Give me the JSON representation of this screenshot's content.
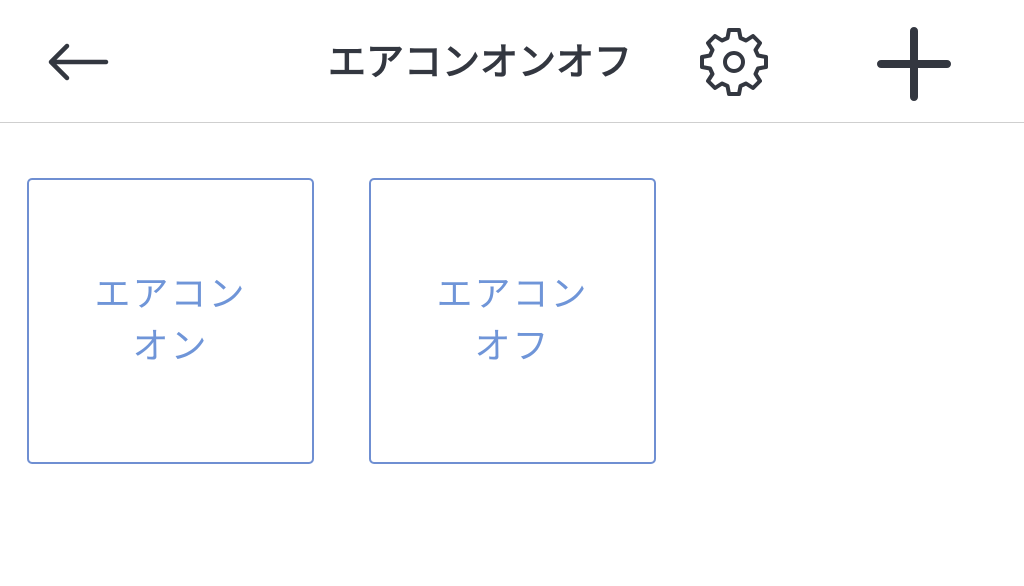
{
  "header": {
    "title": "エアコンオンオフ",
    "back_icon": "arrow-left-icon",
    "settings_icon": "gear-icon",
    "add_icon": "plus-icon"
  },
  "tiles": [
    {
      "label": "エアコン\nオン"
    },
    {
      "label": "エアコン\nオフ"
    }
  ],
  "colors": {
    "icon": "#333740",
    "tile_border": "#6f8fd2",
    "tile_text": "#6f95d8",
    "divider": "#cfcfcf"
  }
}
